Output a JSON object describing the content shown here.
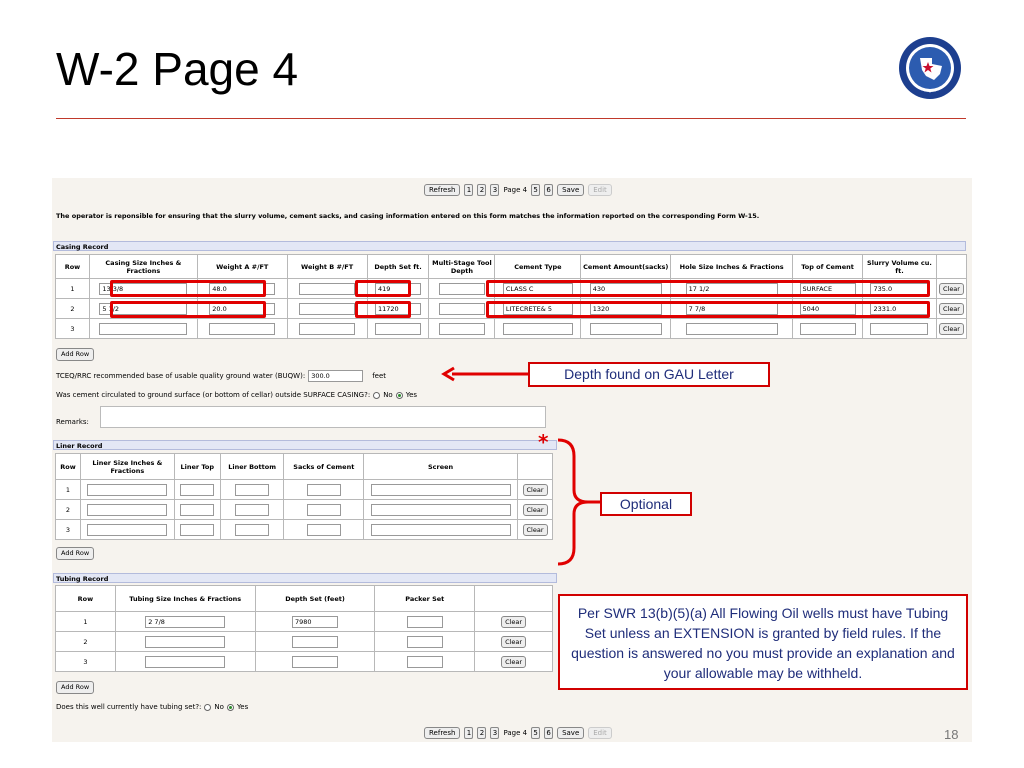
{
  "slide": {
    "title": "W-2 Page 4",
    "number": "18",
    "seal_text": "RAILROAD COMMISSION OF TEXAS"
  },
  "pager": {
    "refresh": "Refresh",
    "pages_before": [
      "1",
      "2",
      "3"
    ],
    "current": "Page 4",
    "pages_after": [
      "5",
      "6"
    ],
    "save": "Save",
    "edit": "Edit"
  },
  "notice": "The operator is reponsible for ensuring that the slurry volume, cement sacks, and casing information entered on this form matches the information reported on the corresponding Form W-15.",
  "casing": {
    "title": "Casing Record",
    "headers": [
      "Row",
      "Casing Size Inches & Fractions",
      "Weight A #/FT",
      "Weight B #/FT",
      "Depth Set ft.",
      "Multi-Stage Tool Depth",
      "Cement Type",
      "Cement Amount(sacks)",
      "Hole Size Inches & Fractions",
      "Top of Cement",
      "Slurry Volume cu. ft."
    ],
    "rows": [
      {
        "row": "1",
        "size": "13 3/8",
        "weight_a": "48.0",
        "weight_b": "",
        "depth": "419",
        "tool_depth": "",
        "cement_type": "CLASS C",
        "cement_amount": "430",
        "hole_size": "17 1/2",
        "top_cement": "SURFACE",
        "slurry": "735.0"
      },
      {
        "row": "2",
        "size": "5 1/2",
        "weight_a": "20.0",
        "weight_b": "",
        "depth": "11720",
        "tool_depth": "",
        "cement_type": "LITECRETE& 5",
        "cement_amount": "1320",
        "hole_size": "7 7/8",
        "top_cement": "5040",
        "slurry": "2331.0"
      },
      {
        "row": "3",
        "size": "",
        "weight_a": "",
        "weight_b": "",
        "depth": "",
        "tool_depth": "",
        "cement_type": "",
        "cement_amount": "",
        "hole_size": "",
        "top_cement": "",
        "slurry": ""
      }
    ],
    "clear_label": "Clear",
    "add_row": "Add Row",
    "buqw_label": "TCEQ/RRC recommended base of usable quality ground water (BUQW):",
    "buqw_value": "300.0",
    "buqw_unit": "feet",
    "circulated_question": "Was cement circulated to ground surface (or bottom of cellar) outside SURFACE CASING?:",
    "no": "No",
    "yes": "Yes",
    "remarks_label": "Remarks:"
  },
  "liner": {
    "title": "Liner Record",
    "headers": [
      "Row",
      "Liner Size Inches & Fractions",
      "Liner Top",
      "Liner Bottom",
      "Sacks of Cement",
      "Screen"
    ],
    "rows": [
      "1",
      "2",
      "3"
    ],
    "clear_label": "Clear",
    "add_row": "Add Row",
    "asterisk": "*"
  },
  "tubing": {
    "title": "Tubing Record",
    "headers": [
      "Row",
      "Tubing Size Inches & Fractions",
      "Depth Set (feet)",
      "Packer Set"
    ],
    "rows": [
      {
        "row": "1",
        "size": "2 7/8",
        "depth": "7980",
        "packer": ""
      },
      {
        "row": "2",
        "size": "",
        "depth": "",
        "packer": ""
      },
      {
        "row": "3",
        "size": "",
        "depth": "",
        "packer": ""
      }
    ],
    "clear_label": "Clear",
    "add_row": "Add Row",
    "question": "Does this well currently have tubing set?:",
    "no": "No",
    "yes": "Yes"
  },
  "callouts": {
    "depth_note": "Depth found on GAU Letter",
    "optional": "Optional",
    "swr_note": "Per SWR 13(b)(5)(a) All Flowing Oil wells must have Tubing Set unless an EXTENSION is granted by field rules. If the question is answered no you must provide an explanation and your allowable may be withheld."
  },
  "colors": {
    "highlight": "#e00000",
    "callout_text": "#1f2d7a",
    "section_header": "#e3e7f5",
    "title_rule": "#c0392b"
  }
}
